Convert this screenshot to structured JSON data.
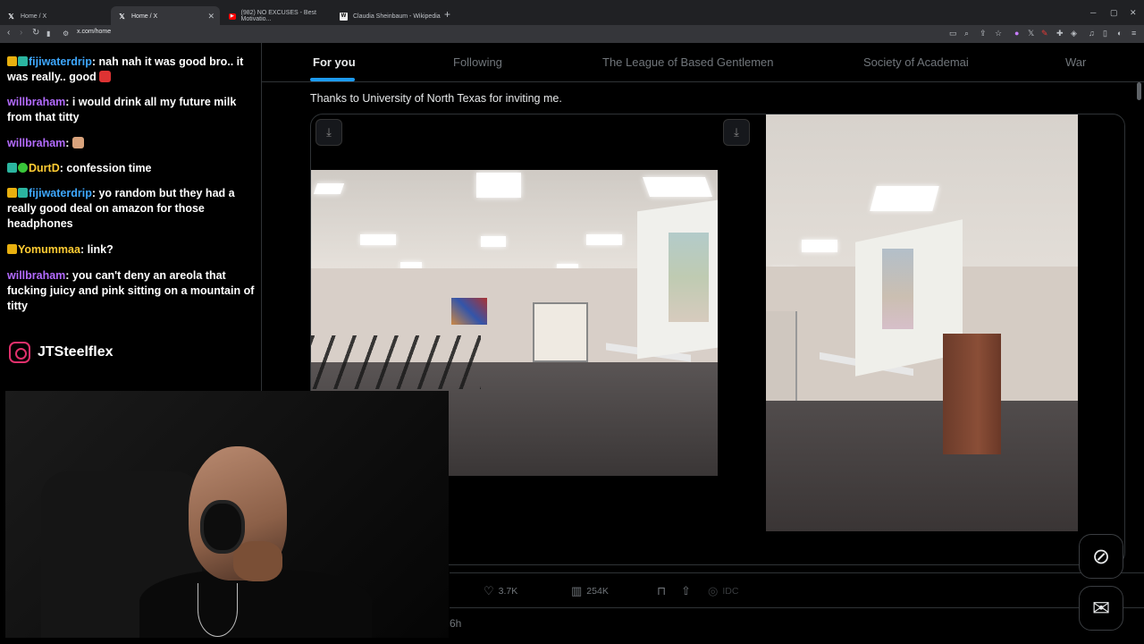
{
  "browser": {
    "tabs": [
      {
        "title": "Home / X",
        "active": false,
        "icon": "x-logo-icon"
      },
      {
        "title": "Home / X",
        "active": true,
        "icon": "x-logo-icon"
      },
      {
        "title": "(982) NO EXCUSES - Best Motivatio...",
        "active": false,
        "icon": "youtube-icon"
      },
      {
        "title": "Claudia Sheinbaum - Wikipedia",
        "active": false,
        "icon": "wikipedia-icon"
      }
    ],
    "url": "x.com/home"
  },
  "chat": {
    "messages": [
      {
        "user": "fijiwaterdrip",
        "text": ": nah nah it was good bro.. it was really.. good",
        "color": "#3ea8ff"
      },
      {
        "user": "willbraham",
        "text": ": i would drink all my future milk from that titty",
        "color": "#b36bff"
      },
      {
        "user": "willbraham",
        "text": ":",
        "color": "#b36bff"
      },
      {
        "user": "DurtD",
        "text": ": confession time",
        "color": "#ffcc33"
      },
      {
        "user": "fijiwaterdrip",
        "text": ": yo random but they had a really good deal on amazon for those headphones",
        "color": "#3ea8ff"
      },
      {
        "user": "Yomummaa",
        "text": ": link?",
        "color": "#ffcc33"
      },
      {
        "user": "willbraham",
        "text": ": you can't deny an areola that fucking juicy and pink sitting on a mountain of titty",
        "color": "#b36bff"
      }
    ],
    "instagram_handle": "JTSteelflex"
  },
  "feed": {
    "tabs": [
      "For you",
      "Following",
      "The League of Based Gentlemen",
      "Society of Academai",
      "War"
    ],
    "active_tab": "For you",
    "post_text": "Thanks to University of North Texas for inviting me.",
    "likes": "3.7K",
    "views": "254K",
    "grok_label": "IDC",
    "timestamp": "6h"
  },
  "colors": {
    "accent": "#1d9bf0",
    "background": "#000000",
    "muted_text": "#71767b"
  }
}
